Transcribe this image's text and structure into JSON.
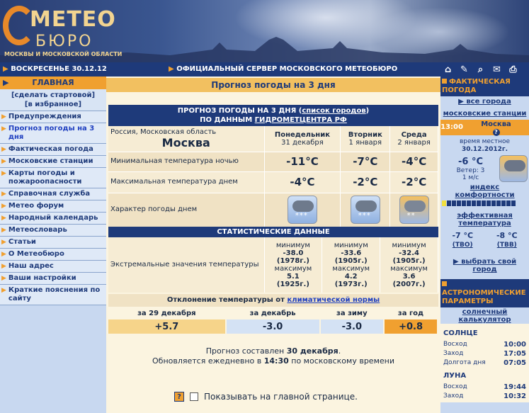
{
  "logo": {
    "word_top": "МЕТЕО",
    "word_mid": "БЮРО",
    "subtitle": "МОСКВЫ И МОСКОВСКОЙ ОБЛАСТИ"
  },
  "topbar": {
    "date": "ВОСКРЕСЕНЬЕ 30.12.12",
    "official": "ОФИЦИАЛЬНЫЙ СЕРВЕР МОСКОВСКОГО МЕТЕОБЮРО",
    "tools": [
      "home-icon",
      "tools-icon",
      "search-icon",
      "mail-icon",
      "print-icon"
    ]
  },
  "leftnav": {
    "home": "ГЛАВНАЯ",
    "start_line1": "[сделать стартовой]",
    "start_line2": "[в избранное]",
    "items": [
      "Предупреждения",
      "Прогноз погоды на 3 дня",
      "Фактическая погода",
      "Московские станции",
      "Карты погоды и пожароопасности",
      "Справочная служба",
      "Метео форум",
      "Народный календарь",
      "Метеословарь",
      "Статьи",
      "О Метеобюро",
      "Наш адрес",
      "Ваши настройки",
      "Краткие пояснения по сайту"
    ]
  },
  "main": {
    "title": "Прогноз погоды на 3 дня",
    "fc_head_line1": "ПРОГНОЗ ПОГОДЫ НА 3 ДНЯ (",
    "fc_head_link1": "список городов",
    "fc_head_line1_end": ")",
    "fc_head_line2": "ПО ДАННЫМ ",
    "fc_head_link2": "ГИДРОМЕТЦЕНТРА РФ",
    "region": "Россия, Московская область",
    "city": "Москва",
    "days": [
      {
        "name": "Понедельник",
        "date": "31 декабря",
        "min": "-11°C",
        "max": "-4°C",
        "icon": "snow-cloud-icon"
      },
      {
        "name": "Вторник",
        "date": "1 января",
        "min": "-7°C",
        "max": "-2°C",
        "icon": "snow-cloud-icon"
      },
      {
        "name": "Среда",
        "date": "2 января",
        "min": "-4°C",
        "max": "-2°C",
        "icon": "sun-cloud-snow-icon"
      }
    ],
    "min_label": "Минимальная температура ночью",
    "max_label": "Максимальная температура днем",
    "character_label": "Характер погоды днем",
    "stat_head": "СТАТИСТИЧЕСКИЕ ДАННЫЕ",
    "extreme_label": "Экстремальные значения температуры",
    "stats": [
      {
        "min_label": "минимум",
        "min": "-38.0",
        "min_year": "(1978г.)",
        "max_label": "максимум",
        "max": "5.1",
        "max_year": "(1925г.)"
      },
      {
        "min_label": "минимум",
        "min": "-33.6",
        "min_year": "(1905г.)",
        "max_label": "максимум",
        "max": "4.2",
        "max_year": "(1973г.)"
      },
      {
        "min_label": "минимум",
        "min": "-32.4",
        "min_year": "(1905г.)",
        "max_label": "максимум",
        "max": "3.6",
        "max_year": "(2007г.)"
      }
    ],
    "dev_title": "Отклонение температуры от ",
    "dev_link": "климатической нормы",
    "deviation": [
      {
        "label": "за 29 декабря",
        "value": "+5.7"
      },
      {
        "label": "за декабрь",
        "value": "-3.0"
      },
      {
        "label": "за зиму",
        "value": "-3.0"
      },
      {
        "label": "за год",
        "value": "+0.8"
      }
    ],
    "note_pre": "Прогноз составлен ",
    "note_date": "30 декабря",
    "note_line2_pre": "Обновляется ежедневно в ",
    "note_time": "14:30",
    "note_line2_post": " по московскому времени",
    "show_main": "Показывать на главной странице."
  },
  "right": {
    "fact_head": "ФАКТИЧЕСКАЯ ПОГОДА",
    "all_cities": "все города",
    "moscow_stations": "московские станции",
    "time": "13:00",
    "city": "Москва",
    "local_time_label": "время местное",
    "local_date": "30.12.2012г.",
    "temp": "-6 °C",
    "wind_label": "Ветер: 3",
    "wind_unit": "1 м/с",
    "comfort_label": "индекс комфортности",
    "eff_label": "эффективная температура",
    "tvo": "-7 °C",
    "tvo_label": "(ТВО)",
    "tvv": "-8 °C",
    "tvv_label": "(ТВВ)",
    "choose_city": "выбрать свой город",
    "astro_head": "АСТРОНОМИЧЕСКИЕ ПАРАМЕТРЫ",
    "solar_calc": "солнечный калькулятор",
    "sun_title": "СОЛНЦЕ",
    "sunrise_label": "Восход",
    "sunrise": "10:00",
    "sunset_label": "Заход",
    "sunset": "17:05",
    "daylen_label": "Долгота дня",
    "daylen": "07:05",
    "moon_title": "ЛУНА",
    "moonrise_label": "Восход",
    "moonrise": "19:44",
    "moonset_label": "Заход",
    "moonset": "10:32"
  }
}
